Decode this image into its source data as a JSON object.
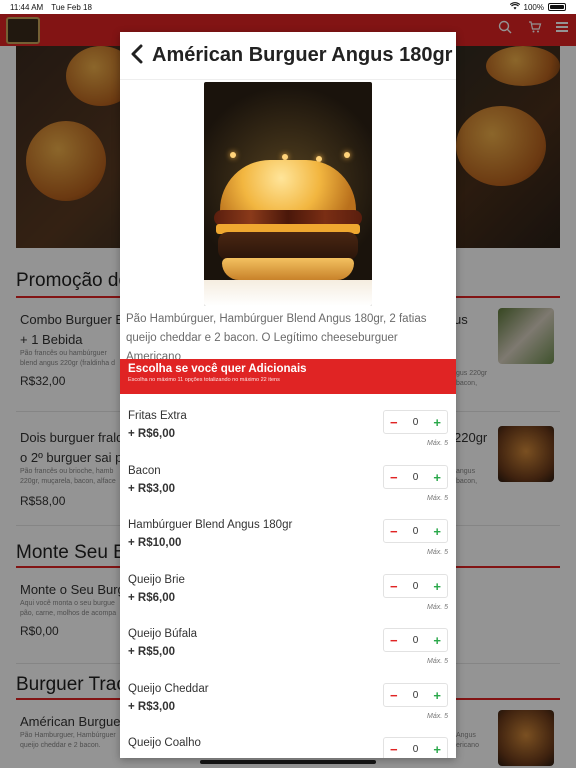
{
  "status_bar": {
    "time": "11:44 AM",
    "date": "Tue Feb 18",
    "battery": "100%"
  },
  "background": {
    "sections": [
      {
        "title": "Promoção do"
      },
      {
        "title": "Monte Seu B"
      },
      {
        "title": "Burguer Trac"
      }
    ],
    "items": [
      {
        "name": "Combo Burguer Bl",
        "name2": "+ 1 Bebida",
        "desc": "Pão francês ou hambúrguer",
        "desc2": "blend angus 220gr (fraldinha d",
        "price": "R$32,00"
      },
      {
        "name": "Dois burguer fraldi",
        "name2": "o 2º burguer sai po",
        "desc": "Pão francês ou brioche, hamb",
        "desc2": "220gr, muçarela, bacon, alface",
        "price": "R$58,00"
      },
      {
        "name": "Monte o Seu Burgu",
        "desc": "Aqui você monta o seu burgue",
        "desc2": "pão, carne, molhos de acompa",
        "price": "R$0,00"
      },
      {
        "name": "Américan Burguer",
        "desc": "Pão Hamburguer, Hambúrguer",
        "desc2": "queijo cheddar e 2 bacon.",
        "price": ""
      }
    ],
    "right_fragments": [
      {
        "name": "us",
        "desc": "gus 220gr",
        "desc2": "bacon,"
      },
      {
        "name": "220gr",
        "desc": "angus",
        "desc2": "bacon,"
      },
      {
        "name": "",
        "desc": "Angus",
        "desc2": "ericano"
      }
    ]
  },
  "modal": {
    "title": "Américan Burguer Angus 180gr",
    "description": "Pão Hambúrguer, Hambúrguer Blend Angus 180gr, 2 fatias queijo cheddar e 2 bacon. O Legítimo cheeseburguer Americano",
    "addons_title": "Escolha se você quer Adicionais",
    "addons_subtitle": "Escolha no máximo 11 opções totalizando no máximo 22 itens",
    "addons": [
      {
        "name": "Fritas Extra",
        "price": "+ R$6,00",
        "qty": "0",
        "max": "Máx. 5"
      },
      {
        "name": "Bacon",
        "price": "+ R$3,00",
        "qty": "0",
        "max": "Máx. 5"
      },
      {
        "name": "Hambúrguer Blend Angus 180gr",
        "price": "+ R$10,00",
        "qty": "0",
        "max": "Máx. 5"
      },
      {
        "name": "Queijo Brie",
        "price": "+ R$6,00",
        "qty": "0",
        "max": "Máx. 5"
      },
      {
        "name": "Queijo Búfala",
        "price": "+ R$5,00",
        "qty": "0",
        "max": "Máx. 5"
      },
      {
        "name": "Queijo Cheddar",
        "price": "+ R$3,00",
        "qty": "0",
        "max": "Máx. 5"
      },
      {
        "name": "Queijo Coalho",
        "price": "",
        "qty": "0",
        "max": ""
      }
    ],
    "stepper_minus": "−",
    "stepper_plus": "+"
  },
  "icons": {
    "back": "chevron-left-icon",
    "search": "search-icon",
    "cart": "cart-icon",
    "menu": "hamburger-menu-icon"
  },
  "colors": {
    "brand_red": "#e02424",
    "plus_green": "#2aa84a"
  }
}
